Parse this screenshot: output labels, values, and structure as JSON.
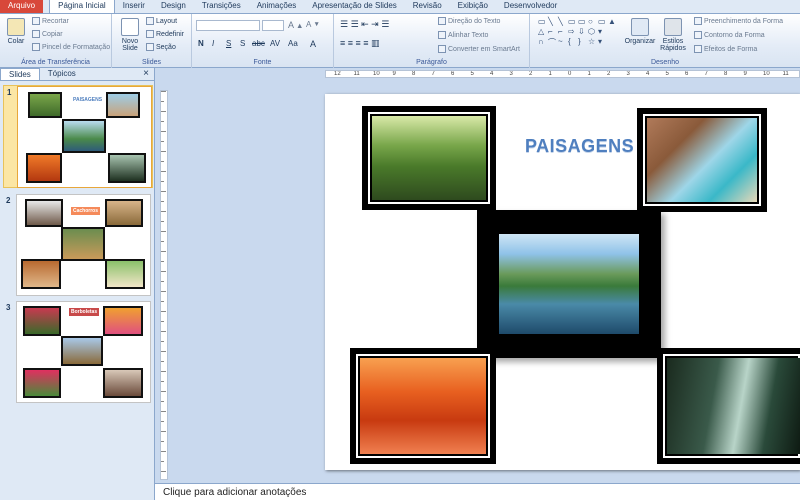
{
  "tabs": [
    "Arquivo",
    "Página Inicial",
    "Inserir",
    "Design",
    "Transições",
    "Animações",
    "Apresentação de Slides",
    "Revisão",
    "Exibição",
    "Desenvolvedor"
  ],
  "ribbon": {
    "clipboard": {
      "paste": "Colar",
      "cut": "Recortar",
      "copy": "Copiar",
      "format_painter": "Pincel de Formatação",
      "label": "Área de Transferência"
    },
    "slides": {
      "new_slide_line1": "Novo",
      "new_slide_line2": "Slide",
      "layout": "Layout",
      "reset": "Redefinir",
      "section": "Seção",
      "label": "Slides"
    },
    "font": {
      "label": "Fonte",
      "bold": "N",
      "italic": "I",
      "underline": "S",
      "shadow": "S",
      "strike": "abc",
      "spacing": "AV",
      "case": "Aa",
      "color": "A"
    },
    "paragraph": {
      "text_direction": "Direção do Texto",
      "align_text": "Alinhar Texto",
      "smartart": "Converter em SmartArt",
      "label": "Parágrafo"
    },
    "drawing": {
      "arrange": "Organizar",
      "quick_styles_line1": "Estilos",
      "quick_styles_line2": "Rápidos",
      "shape_fill": "Preenchimento da Forma",
      "shape_outline": "Contorno da Forma",
      "shape_effects": "Efeitos de Forma",
      "label": "Desenho"
    }
  },
  "left_panel": {
    "tab_slides": "Slides",
    "tab_outline": "Tópicos",
    "close": "×"
  },
  "thumbnails": [
    {
      "num": "1",
      "title": "PAISAGENS"
    },
    {
      "num": "2",
      "title": "Cachorros"
    },
    {
      "num": "3",
      "title": "Borboletas"
    }
  ],
  "slide": {
    "title": "PAISAGENS"
  },
  "notes": {
    "placeholder": "Clique para adicionar anotações"
  },
  "ruler_labels": [
    "12",
    "11",
    "10",
    "9",
    "8",
    "7",
    "6",
    "5",
    "4",
    "3",
    "2",
    "1",
    "0",
    "1",
    "2",
    "3",
    "4",
    "5",
    "6",
    "7",
    "8",
    "9",
    "10",
    "11"
  ],
  "colors": {
    "file_tab": "#d8483a",
    "selected_thumb": "#fbe6a5",
    "title": "#4f7fbf"
  }
}
